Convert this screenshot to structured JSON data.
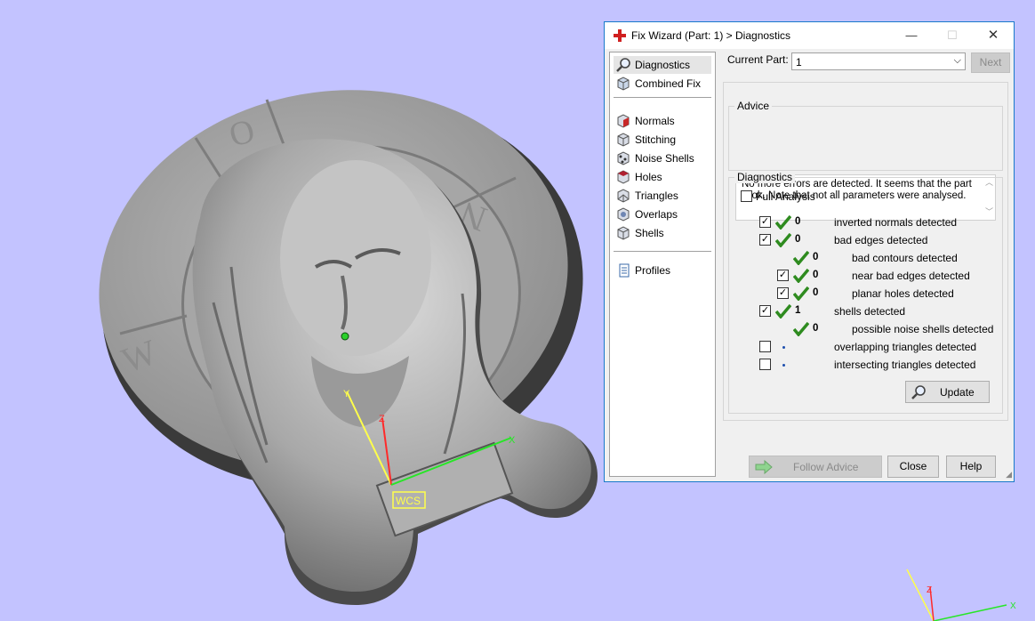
{
  "dialog": {
    "title": "Fix Wizard (Part: 1) > Diagnostics",
    "window_buttons": {
      "minimize": "—",
      "maximize": "☐",
      "close": "✕"
    }
  },
  "nav": {
    "items": [
      {
        "label": "Diagnostics",
        "icon": "magnifier-icon",
        "selected": true
      },
      {
        "label": "Combined Fix",
        "icon": "cube-icon"
      },
      {
        "label": "Normals",
        "icon": "normals-icon"
      },
      {
        "label": "Stitching",
        "icon": "stitching-icon"
      },
      {
        "label": "Noise Shells",
        "icon": "noise-shells-icon"
      },
      {
        "label": "Holes",
        "icon": "holes-icon"
      },
      {
        "label": "Triangles",
        "icon": "triangles-icon"
      },
      {
        "label": "Overlaps",
        "icon": "overlaps-icon"
      },
      {
        "label": "Shells",
        "icon": "shells-icon"
      },
      {
        "label": "Profiles",
        "icon": "document-icon"
      }
    ]
  },
  "part": {
    "label": "Current Part:",
    "value": "1",
    "next_label": "Next"
  },
  "advice": {
    "title": "Advice",
    "text": "No more errors are detected. It seems that the part is ok. Note that not all parameters were analysed."
  },
  "diagnostics": {
    "title": "Diagnostics",
    "full_analysis_label": "Full Analysis",
    "full_analysis_checked": false,
    "rows": [
      {
        "checked": true,
        "status": "ok",
        "count": "0",
        "label": "inverted normals detected"
      },
      {
        "checked": true,
        "status": "ok",
        "count": "0",
        "label": "bad edges detected"
      },
      {
        "checked": null,
        "status": "ok",
        "count": "0",
        "label": "bad contours detected"
      },
      {
        "checked": true,
        "status": "ok",
        "count": "0",
        "label": "near bad edges detected"
      },
      {
        "checked": true,
        "status": "ok",
        "count": "0",
        "label": "planar holes detected"
      },
      {
        "checked": true,
        "status": "ok",
        "count": "1",
        "label": "shells detected"
      },
      {
        "checked": null,
        "status": "ok",
        "count": "0",
        "label": "possible noise shells detected"
      },
      {
        "checked": false,
        "status": "pending",
        "count": "",
        "label": "overlapping triangles detected"
      },
      {
        "checked": false,
        "status": "pending",
        "count": "",
        "label": "intersecting triangles detected"
      }
    ],
    "update_label": "Update"
  },
  "footer": {
    "follow_advice_label": "Follow Advice",
    "close_label": "Close",
    "help_label": "Help"
  },
  "viewport": {
    "wcs_label": "WCS",
    "axis_x": "X",
    "axis_y": "Y",
    "axis_z": "Z"
  }
}
